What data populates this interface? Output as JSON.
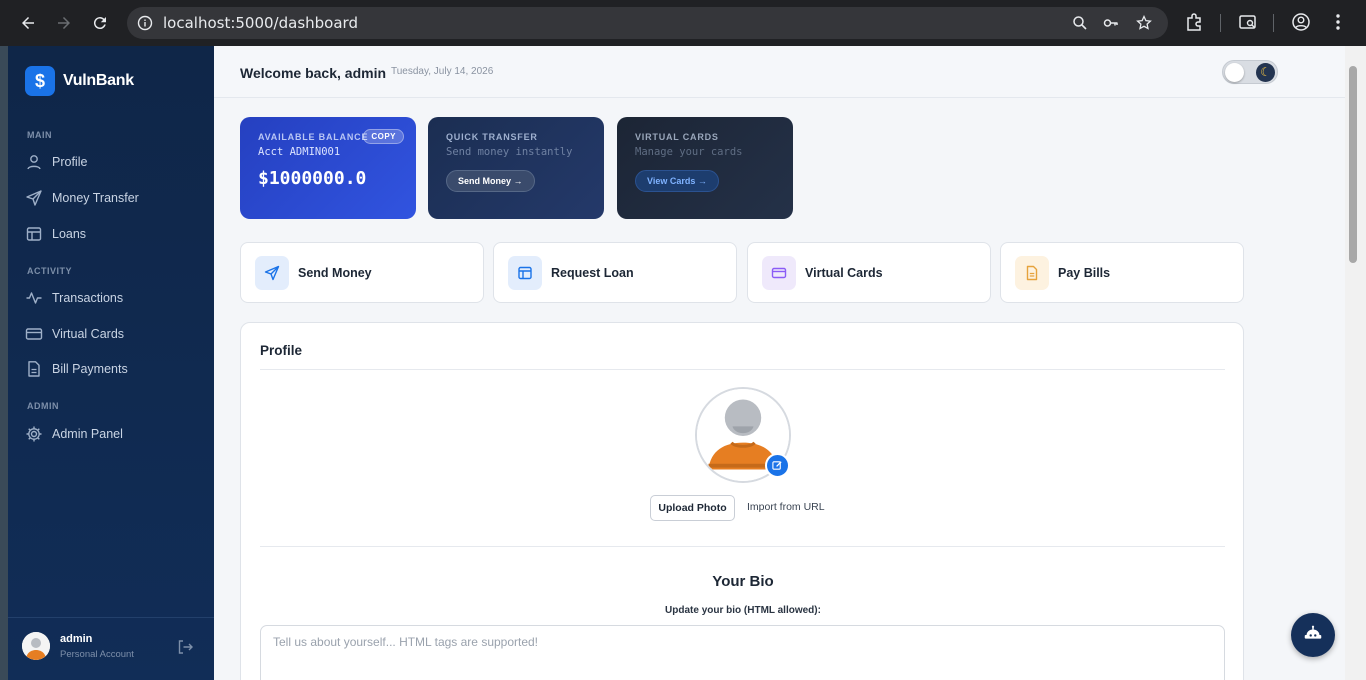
{
  "browser": {
    "url": "localhost:5000/dashboard"
  },
  "brand": {
    "logo_symbol": "$",
    "name": "VulnBank"
  },
  "sidebar": {
    "sections": [
      {
        "title": "MAIN"
      },
      {
        "title": "ACTIVITY"
      },
      {
        "title": "ADMIN"
      }
    ],
    "items": [
      {
        "label": "Profile",
        "icon": "user-icon"
      },
      {
        "label": "Money Transfer",
        "icon": "send-icon"
      },
      {
        "label": "Loans",
        "icon": "table-icon"
      },
      {
        "label": "Transactions",
        "icon": "activity-icon"
      },
      {
        "label": "Virtual Cards",
        "icon": "credit-card-icon"
      },
      {
        "label": "Bill Payments",
        "icon": "file-icon"
      },
      {
        "label": "Admin Panel",
        "icon": "gear-icon"
      }
    ],
    "footer": {
      "name": "admin",
      "role": "Personal Account"
    }
  },
  "header": {
    "welcome": "Welcome back, admin",
    "date": "Tuesday, July 14, 2026",
    "theme": "light"
  },
  "hero_cards": [
    {
      "label": "AVAILABLE BALANCE",
      "sub": "Acct ADMIN001",
      "amount": "$1000000.0",
      "copy_label": "COPY"
    },
    {
      "label": "QUICK TRANSFER",
      "sub": "Send money instantly",
      "button": "Send Money →"
    },
    {
      "label": "VIRTUAL CARDS",
      "sub": "Manage your cards",
      "button": "View Cards →"
    }
  ],
  "quick_actions": [
    {
      "label": "Send Money",
      "icon": "send-icon"
    },
    {
      "label": "Request Loan",
      "icon": "table-icon"
    },
    {
      "label": "Virtual Cards",
      "icon": "credit-card-icon"
    },
    {
      "label": "Pay Bills",
      "icon": "file-icon"
    }
  ],
  "profile": {
    "title": "Profile",
    "upload_label": "Upload Photo",
    "import_label": "Import from URL",
    "bio_title": "Your Bio",
    "bio_subtitle": "Update your bio (HTML allowed):",
    "bio_placeholder": "Tell us about yourself... HTML tags are supported!",
    "bio_value": ""
  },
  "colors": {
    "sidebar": "#0f2648",
    "accent": "#1a73e8",
    "balance_card": "#2e4bd6",
    "transfer_card": "#1d3158",
    "cards_card": "#1e2a3d"
  }
}
